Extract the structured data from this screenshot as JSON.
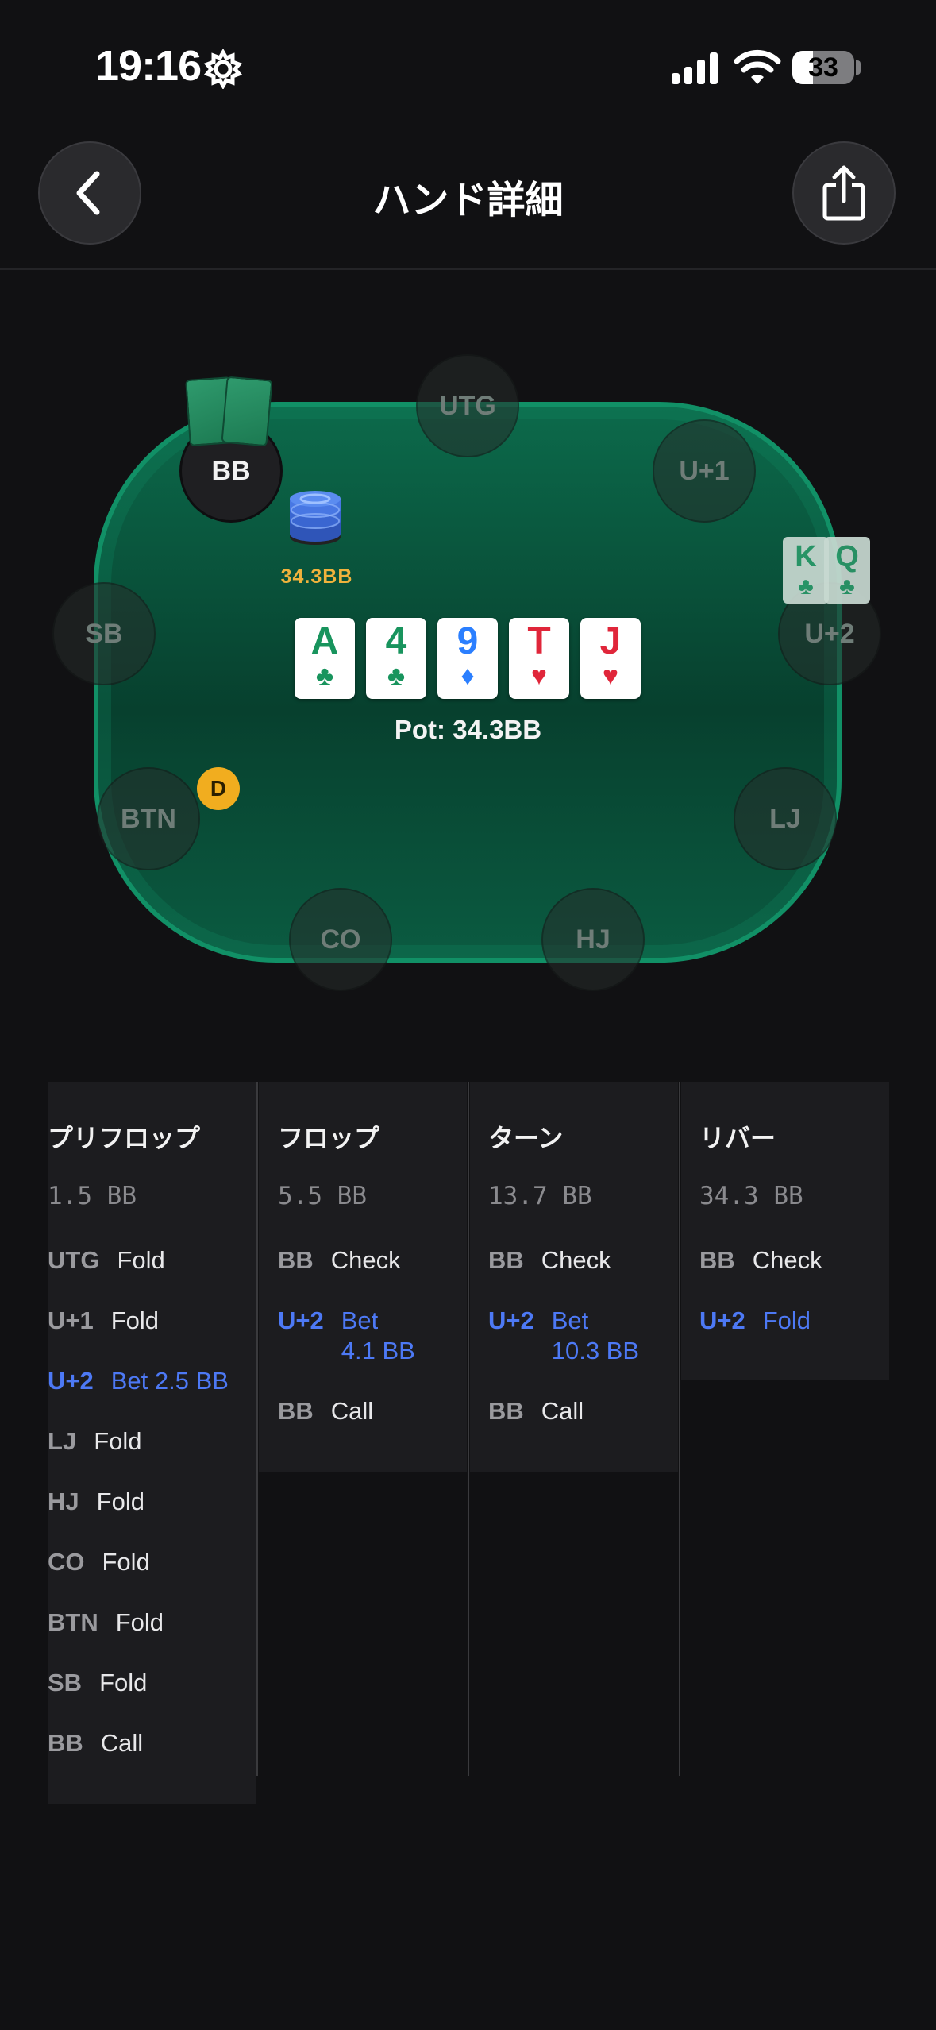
{
  "status_bar": {
    "time": "19:16",
    "battery": "33"
  },
  "header": {
    "title": "ハンド詳細"
  },
  "table": {
    "seats": [
      "UTG",
      "U+1",
      "U+2",
      "LJ",
      "HJ",
      "CO",
      "BTN",
      "SB",
      "BB"
    ],
    "dealer_label": "D",
    "bb_stack": "34.3BB",
    "board": [
      {
        "rank": "A",
        "suit": "♣"
      },
      {
        "rank": "4",
        "suit": "♣"
      },
      {
        "rank": "9",
        "suit": "♦"
      },
      {
        "rank": "T",
        "suit": "♥"
      },
      {
        "rank": "J",
        "suit": "♥"
      }
    ],
    "pot": "Pot: 34.3BB",
    "villain_cards": [
      {
        "rank": "K",
        "suit": "♣"
      },
      {
        "rank": "Q",
        "suit": "♣"
      }
    ]
  },
  "history": [
    {
      "title": "プリフロップ",
      "pot": "1.5 BB",
      "actions": [
        {
          "pos": "UTG",
          "text": "Fold"
        },
        {
          "pos": "U+1",
          "text": "Fold"
        },
        {
          "pos": "U+2",
          "text": "Bet 2.5 BB"
        },
        {
          "pos": "LJ",
          "text": "Fold"
        },
        {
          "pos": "HJ",
          "text": "Fold"
        },
        {
          "pos": "CO",
          "text": "Fold"
        },
        {
          "pos": "BTN",
          "text": "Fold"
        },
        {
          "pos": "SB",
          "text": "Fold"
        },
        {
          "pos": "BB",
          "text": "Call"
        }
      ]
    },
    {
      "title": "フロップ",
      "pot": "5.5 BB",
      "actions": [
        {
          "pos": "BB",
          "text": "Check"
        },
        {
          "pos": "U+2",
          "text": "Bet\n4.1 BB"
        },
        {
          "pos": "BB",
          "text": "Call"
        }
      ]
    },
    {
      "title": "ターン",
      "pot": "13.7 BB",
      "actions": [
        {
          "pos": "BB",
          "text": "Check"
        },
        {
          "pos": "U+2",
          "text": "Bet\n10.3 BB"
        },
        {
          "pos": "BB",
          "text": "Call"
        }
      ]
    },
    {
      "title": "リバー",
      "pot": "34.3 BB",
      "actions": [
        {
          "pos": "BB",
          "text": "Check"
        },
        {
          "pos": "U+2",
          "text": "Fold"
        }
      ]
    }
  ]
}
